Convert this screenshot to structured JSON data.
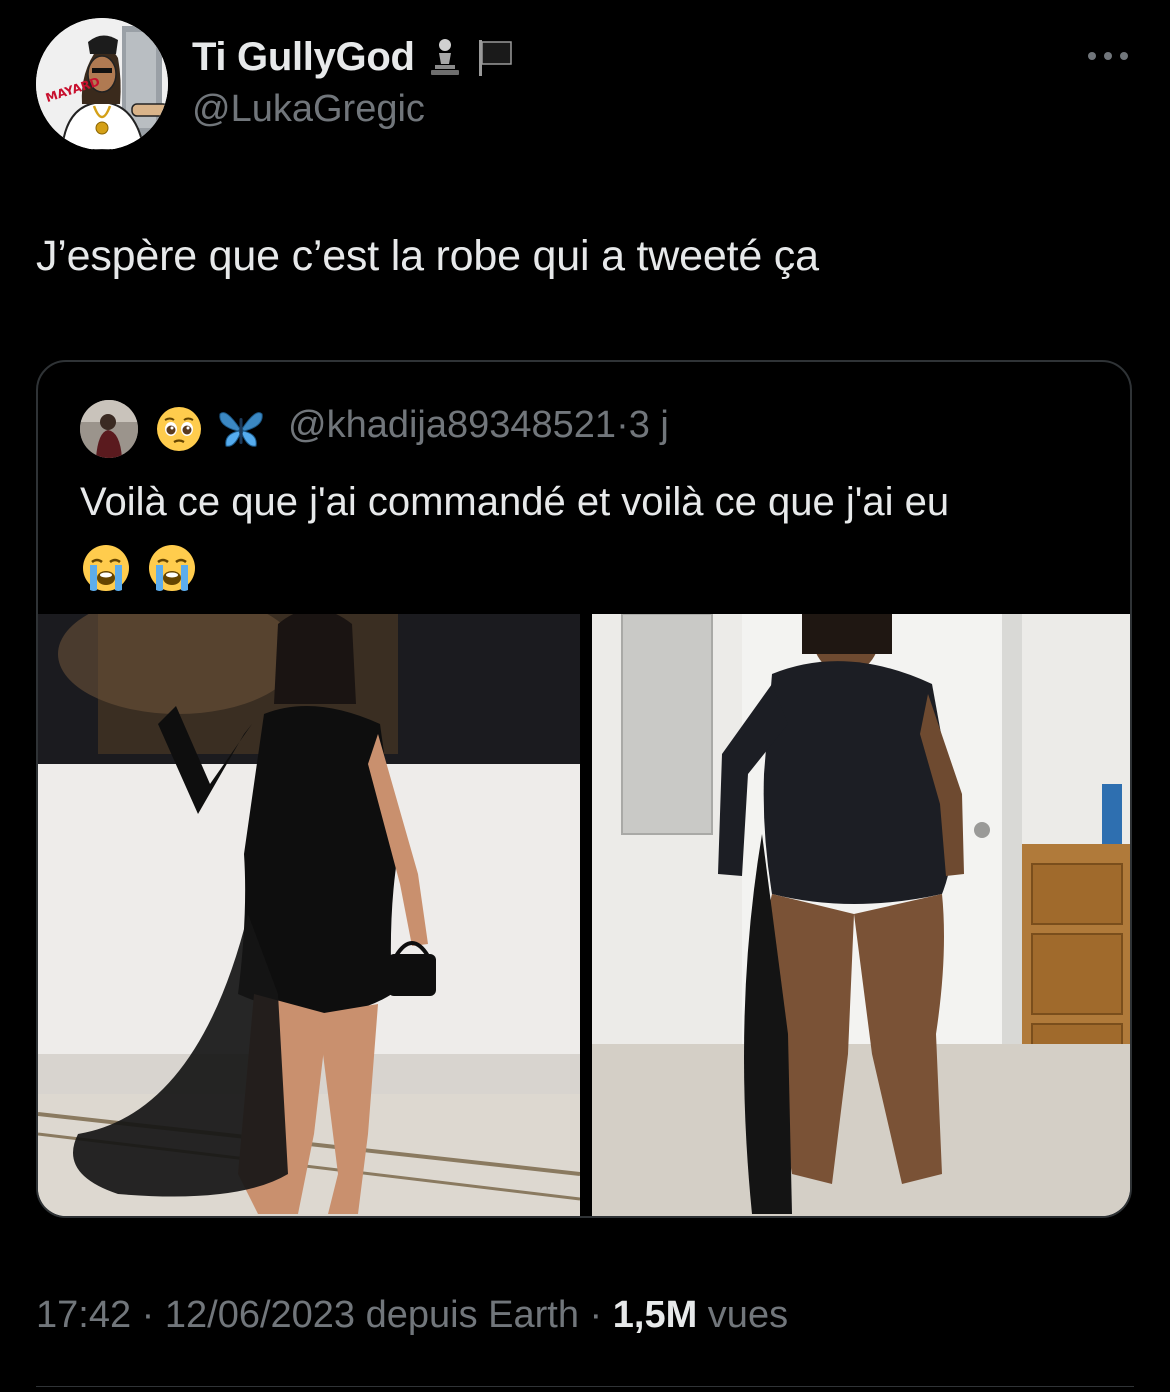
{
  "tweet": {
    "author": {
      "display_name": "Ti GullyGod",
      "handle": "@LukaGregic",
      "name_icons": [
        "chess-pawn-icon",
        "black-flag-icon"
      ]
    },
    "text": "J’espère que c’est la robe qui a tweeté ça",
    "more_icon": "more-options-icon"
  },
  "quote": {
    "emojis": [
      "pleading-face-icon",
      "butterfly-icon"
    ],
    "handle": "@khadija89348521",
    "separator": "·",
    "time": "3 j",
    "text": "Voilà ce que j'ai commandé et voilà ce que j'ai eu",
    "trailing_emojis": [
      "loudly-crying-face-icon",
      "loudly-crying-face-icon"
    ]
  },
  "meta": {
    "time": "17:42",
    "sep1": " · ",
    "date": "12/06/2023",
    "source": " depuis Earth",
    "sep2": " · ",
    "views_count": "1,5M",
    "views_label": " vues"
  },
  "colors": {
    "background": "#000000",
    "text_primary": "#e7e9ea",
    "text_secondary": "#71767b",
    "border": "#2f3336"
  }
}
